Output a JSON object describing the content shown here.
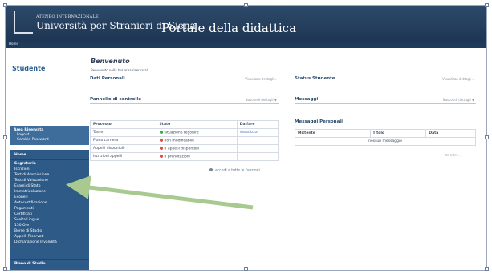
{
  "header": {
    "university_top": "ATENEO INTERNAZIONALE",
    "university_name": "Università per Stranieri di Siena",
    "portal_title": "Portale della didattica",
    "home_link": "Home"
  },
  "sidebar": {
    "title": "Studente",
    "area": [
      "Area Riservata",
      "Logout",
      "Cambia Password"
    ],
    "menu": [
      "Home",
      "Segreteria",
      "Iscrizioni",
      "Test di Ammissione",
      "Test di Valutazione",
      "Esami di Stato",
      "Immatricolazione",
      "Esoneri",
      "Autocertificazione",
      "Pagamenti",
      "Certificati",
      "Scelta Lingue",
      "150 Ore",
      "Borse di Studio",
      "Appelli Riservati",
      "Dichiarazione Invalidità",
      "Piano di Studio"
    ]
  },
  "main": {
    "welcome": "Benvenuto",
    "welcome_sub": "Benvenuto nella tua area riservata!",
    "dati_personali": "Dati Personali",
    "dati_action": "Visualizza dettagli »",
    "status": "Status Studente",
    "status_action": "Visualizza dettagli »",
    "pannello": "Pannello di controllo",
    "pannello_action": "Nascondi dettagli ▼",
    "messaggi": "Messaggi",
    "messaggi_action": "Nascondi dettagli ▼",
    "table_headers": [
      "Processo",
      "Stato",
      "Da fare"
    ],
    "table_rows": [
      [
        "Tasse",
        "situazione regolare",
        "visualizza"
      ],
      [
        "Piano carriera",
        "non modificabile",
        ""
      ],
      [
        "Appelli disponibili",
        "0 appelli disponibili",
        ""
      ],
      [
        "Iscrizioni appelli",
        "0 prenotazioni",
        ""
      ]
    ],
    "funzioni": "accedi a tutte le funzioni",
    "messaggi_personali": "Messaggi Personali",
    "msg_headers": [
      "Mittente",
      "Titolo",
      "Data"
    ],
    "msg_empty": "nessun messaggio",
    "altri": "altri..."
  },
  "colors": {
    "header": "#24405f",
    "sidebar_menu": "#2d5a87",
    "accent_text": "#2b5f8f",
    "green_dot": "#3ea84a",
    "red_dot": "#d94b3f",
    "arrow": "#a8c98f"
  }
}
